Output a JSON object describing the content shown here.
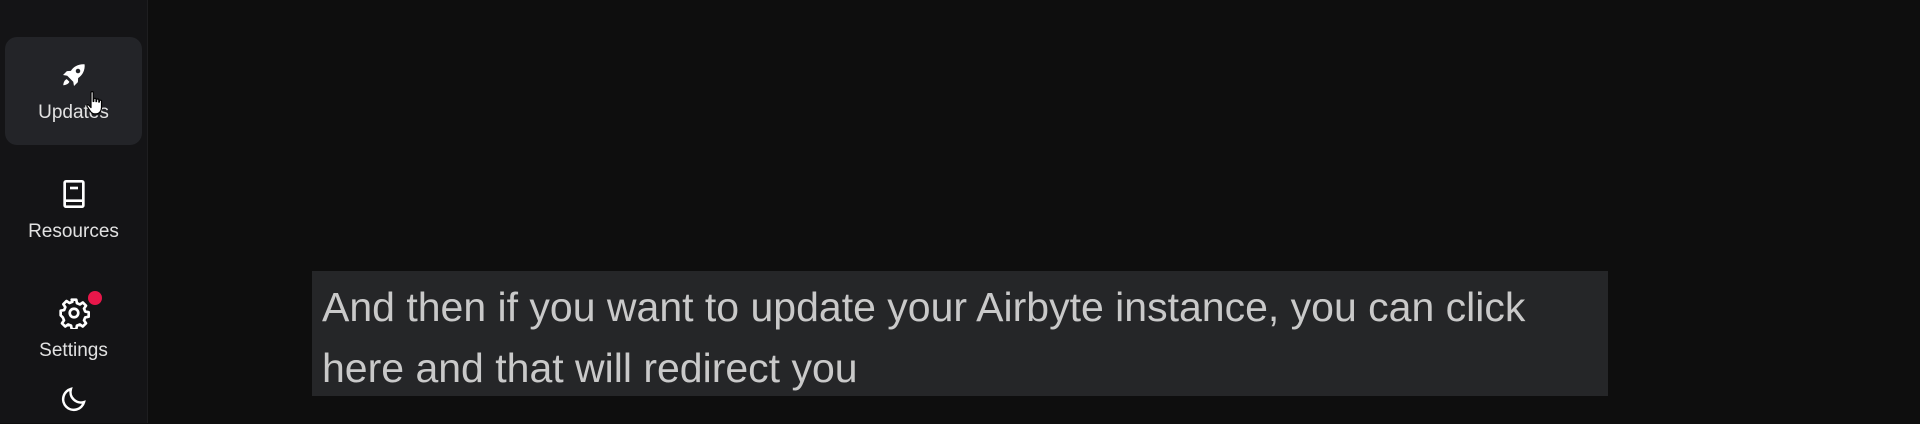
{
  "sidebar": {
    "items": [
      {
        "label": "Updates",
        "icon": "rocket-icon",
        "active": true
      },
      {
        "label": "Resources",
        "icon": "book-icon",
        "active": false
      },
      {
        "label": "Settings",
        "icon": "gear-icon",
        "active": false,
        "badge_color": "#e8174a"
      },
      {
        "label": "",
        "icon": "moon-icon",
        "active": false
      }
    ]
  },
  "caption": {
    "text": "And then if you want to update your Airbyte instance, you can click here and that will redirect you"
  },
  "colors": {
    "background": "#0e0e0e",
    "sidebar_bg": "#141416",
    "active_item_bg": "#232428",
    "caption_bg": "#252628",
    "notification_dot": "#e8174a"
  }
}
